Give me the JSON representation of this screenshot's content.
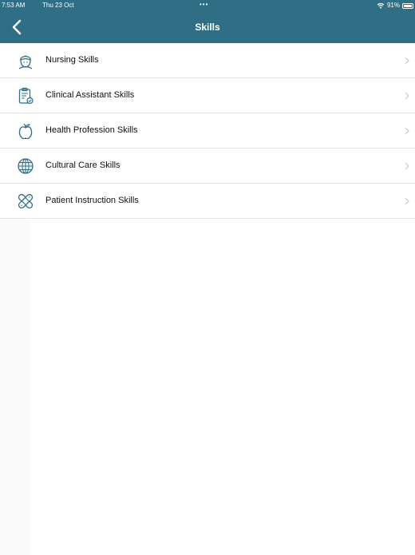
{
  "status_bar": {
    "time": "7:53 AM",
    "date": "Thu 23 Oct",
    "dots": "•••",
    "battery": "91%"
  },
  "nav": {
    "title": "Skills",
    "back_icon": "chevron-left-icon"
  },
  "colors": {
    "header_bg": "#2f6f86",
    "icon_color": "#2f6f86"
  },
  "skills": [
    {
      "label": "Nursing Skills",
      "icon": "nurse-icon"
    },
    {
      "label": "Clinical Assistant Skills",
      "icon": "clipboard-icon"
    },
    {
      "label": "Health Profession Skills",
      "icon": "apple-icon"
    },
    {
      "label": "Cultural Care Skills",
      "icon": "globe-icon"
    },
    {
      "label": "Patient Instruction Skills",
      "icon": "bandage-icon"
    }
  ]
}
